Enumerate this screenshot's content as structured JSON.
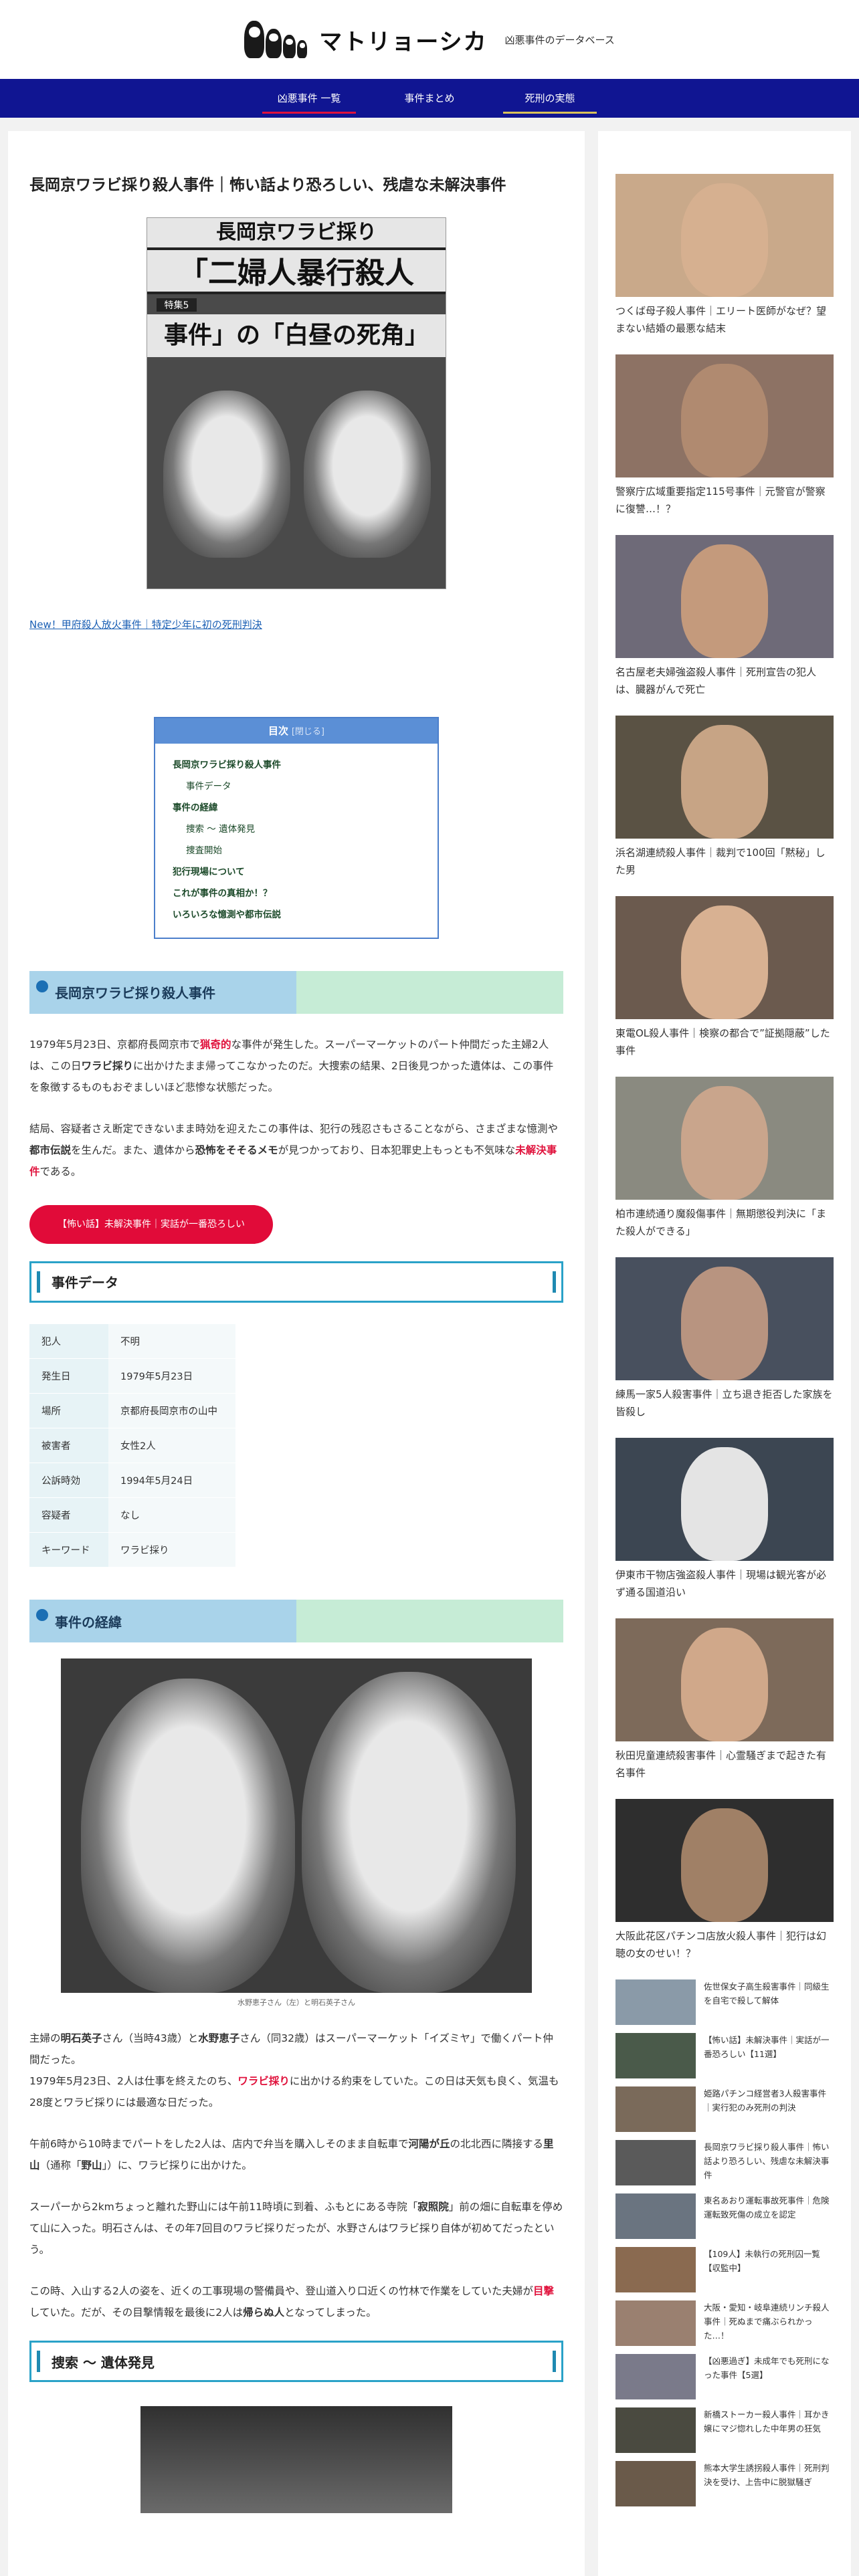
{
  "site": {
    "title": "マトリョーシカ",
    "description": "凶悪事件のデータベース"
  },
  "nav": [
    {
      "label": "凶悪事件 一覧",
      "bar_color": "#e0123c"
    },
    {
      "label": "事件まとめ",
      "bar_color": "#101592"
    },
    {
      "label": "死刑の実態",
      "bar_color": "#d9c15a"
    }
  ],
  "article": {
    "title": "長岡京ワラビ採り殺人事件｜怖い話より恐ろしい、残虐な未解決事件",
    "eyecatch_lines": [
      "長岡京ワラビ採り",
      "「二婦人暴行殺人",
      "特集5",
      "事件」の「白昼の死角」"
    ],
    "related_link": "New！甲府殺人放火事件｜特定少年に初の死刑判決",
    "toc": {
      "title": "目次",
      "toggle": "[閉じる]",
      "items": [
        {
          "label": "長岡京ワラビ採り殺人事件",
          "level": 1
        },
        {
          "label": "事件データ",
          "level": 2
        },
        {
          "label": "事件の経緯",
          "level": 1
        },
        {
          "label": "捜索 ～ 遺体発見",
          "level": 2
        },
        {
          "label": "捜査開始",
          "level": 2
        },
        {
          "label": "犯行現場について",
          "level": 1
        },
        {
          "label": "これが事件の真相か！？",
          "level": 1
        },
        {
          "label": "いろいろな憶測や都市伝説",
          "level": 1
        }
      ]
    },
    "section1_heading": "長岡京ワラビ採り殺人事件",
    "para1": {
      "a": "1979年5月23日、京都府長岡京市で",
      "b": "猟奇的",
      "c": "な事件が発生した。スーパーマーケットのパート仲間だった主婦2人は、この日",
      "d": "ワラビ採り",
      "e": "に出かけたまま帰ってこなかったのだ。大捜索の結果、2日後見つかった遺体は、この事件を象徴するものもおぞましいほど悲惨な状態だった。"
    },
    "para2": {
      "a": "結局、容疑者さえ断定できないまま時効を迎えたこの事件は、犯行の残忍さもさることながら、さまざまな憶測や",
      "b": "都市伝説",
      "c": "を生んだ。また、遺体から",
      "d": "恐怖をそそるメモ",
      "e": "が見つかっており、日本犯罪史上もっとも不気味な",
      "f": "未解決事件",
      "g": "である。"
    },
    "red_button": "【怖い話】未解決事件｜実話が一番恐ろしい",
    "data_heading": "事件データ",
    "data_rows": [
      {
        "k": "犯人",
        "v": "不明"
      },
      {
        "k": "発生日",
        "v": "1979年5月23日"
      },
      {
        "k": "場所",
        "v": "京都府長岡京市の山中"
      },
      {
        "k": "被害者",
        "v": "女性2人"
      },
      {
        "k": "公訴時効",
        "v": "1994年5月24日"
      },
      {
        "k": "容疑者",
        "v": "なし"
      },
      {
        "k": "キーワード",
        "v": "ワラビ採り"
      }
    ],
    "section2_heading": "事件の経緯",
    "photo_caption": "水野恵子さん（左）と明石英子さん",
    "para3": {
      "a": "主婦の",
      "b": "明石英子",
      "c": "さん（当時43歳）と",
      "d": "水野恵子",
      "e": "さん（同32歳）はスーパーマーケット「イズミヤ」で働くパート仲間だった。",
      "f": "1979年5月23日、2人は仕事を終えたのち、",
      "g": "ワラビ採り",
      "h": "に出かける約束をしていた。この日は天気も良く、気温も28度とワラビ採りには最適な日だった。"
    },
    "para4": {
      "a": "午前6時から10時までパートをした2人は、店内で弁当を購入しそのまま自転車で",
      "b": "河陽が丘",
      "c": "の北北西に隣接する",
      "d": "里山",
      "e": "（通称「",
      "f": "野山",
      "g": "」）に、ワラビ採りに出かけた。"
    },
    "para5": {
      "a": "スーパーから2kmちょっと離れた野山には午前11時頃に到着、ふもとにある寺院「",
      "b": "寂照院",
      "c": "」前の畑に自転車を停めて山に入った。明石さんは、その年7回目のワラビ採りだったが、水野さんはワラビ採り自体が初めてだったという。"
    },
    "para6": {
      "a": "この時、入山する2人の姿を、近くの工事現場の警備員や、登山道入り口近くの竹林で作業をしていた夫婦が",
      "b": "目撃",
      "c": "していた。だが、その目撃情報を最後に2人は",
      "d": "帰らぬ人",
      "e": "となってしまった。"
    },
    "subsection_heading": "捜索 ～ 遺体発見"
  },
  "sidebar": {
    "cards": [
      {
        "title": "つくば母子殺人事件｜エリート医師がなぜ？望まない結婚の最悪な結末",
        "bg": "#c9a98a",
        "face": "#d6b090"
      },
      {
        "title": "警察庁広域重要指定115号事件｜元警官が警察に復讐…！？",
        "bg": "#8d7264",
        "face": "#b08a70"
      },
      {
        "title": "名古屋老夫婦強盗殺人事件｜死刑宣告の犯人は、臓器がんで死亡",
        "bg": "#6e6a78",
        "face": "#c49a7c"
      },
      {
        "title": "浜名湖連続殺人事件｜裁判で100回「黙秘」した男",
        "bg": "#5a5244",
        "face": "#c7a485"
      },
      {
        "title": "東電OL殺人事件｜検察の都合で”証拠隠蔽”した事件",
        "bg": "#6b5a4e",
        "face": "#d8b192"
      },
      {
        "title": "柏市連続通り魔殺傷事件｜無期懲役判決に「また殺人ができる」",
        "bg": "#8a8a80",
        "face": "#c9a58c"
      },
      {
        "title": "練馬一家5人殺害事件｜立ち退き拒否した家族を皆殺し",
        "bg": "#48505e",
        "face": "#b89480"
      },
      {
        "title": "伊東市干物店強盗殺人事件｜現場は観光客が必ず通る国道沿い",
        "bg": "#3c4652",
        "face": "#e4e4e4"
      },
      {
        "title": "秋田児童連続殺害事件｜心霊騒ぎまで起きた有名事件",
        "bg": "#7d6a5a",
        "face": "#d0a88a"
      },
      {
        "title": "大阪此花区パチンコ店放火殺人事件｜犯行は幻聴の女のせい！？",
        "bg": "#2e2e2e",
        "face": "#a08066"
      }
    ],
    "minis": [
      {
        "title": "佐世保女子高生殺害事件｜同級生を自宅で殺して解体",
        "bg": "#8a9aa8"
      },
      {
        "title": "【怖い話】未解決事件｜実話が一番恐ろしい【11選】",
        "bg": "#4a5a4a"
      },
      {
        "title": "姫路パチンコ経営者3人殺害事件｜実行犯のみ死刑の判決",
        "bg": "#7a6a5a"
      },
      {
        "title": "長岡京ワラビ採り殺人事件｜怖い話より恐ろしい、残虐な未解決事件",
        "bg": "#5a5a5a"
      },
      {
        "title": "東名あおり運転事故死事件｜危険運転致死傷の成立を認定",
        "bg": "#6a7480"
      },
      {
        "title": "【109人】未執行の死刑囚一覧【収監中】",
        "bg": "#8a6a50"
      },
      {
        "title": "大阪・愛知・岐阜連続リンチ殺人事件｜死ぬまで痛ぶられかった…！",
        "bg": "#9a8070"
      },
      {
        "title": "【凶悪過ぎ】未成年でも死刑になった事件【5選】",
        "bg": "#7a7a8a"
      },
      {
        "title": "新橋ストーカー殺人事件｜耳かき嬢にマジ惚れした中年男の狂気",
        "bg": "#4a4a40"
      },
      {
        "title": "熊本大学生誘拐殺人事件｜死刑判決を受け、上告中に脱獄騒ぎ",
        "bg": "#6a5a4a"
      }
    ]
  }
}
